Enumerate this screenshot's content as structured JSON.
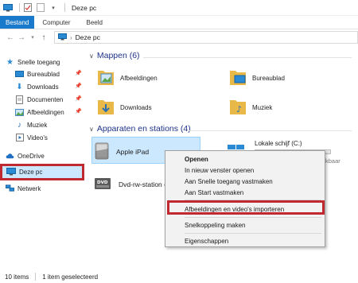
{
  "window": {
    "title": "Deze pc"
  },
  "ribbon": {
    "tabs": [
      "Bestand",
      "Computer",
      "Beeld"
    ]
  },
  "address": {
    "path": "Deze pc"
  },
  "nav": {
    "quick_access": "Snelle toegang",
    "quick_items": [
      "Bureaublad",
      "Downloads",
      "Documenten",
      "Afbeeldingen",
      "Muziek",
      "Video's"
    ],
    "onedrive": "OneDrive",
    "this_pc": "Deze pc",
    "network": "Netwerk"
  },
  "folders_group": {
    "header": "Mappen (6)",
    "items": [
      "Afbeeldingen",
      "Bureaublad",
      "Downloads",
      "Muziek"
    ]
  },
  "devices_group": {
    "header": "Apparaten en stations (4)",
    "ipad": "Apple iPad",
    "dvd": "Dvd-rw-station (",
    "local_disk": "Lokale schijf (C:)",
    "local_disk_free_partial": "kbaar",
    "local_disk_used_fraction": 0.62
  },
  "context_menu": {
    "items": [
      "Openen",
      "In nieuw venster openen",
      "Aan Snelle toegang vastmaken",
      "Aan Start vastmaken",
      "Afbeeldingen en video's importeren",
      "Snelkoppeling maken",
      "Eigenschappen"
    ]
  },
  "status": {
    "count": "10 items",
    "selected": "1 item geselecteerd"
  },
  "colors": {
    "accent": "#1979ca",
    "highlight_red": "#c0292f",
    "folder": "#e8b949",
    "selection": "#cce8ff"
  }
}
